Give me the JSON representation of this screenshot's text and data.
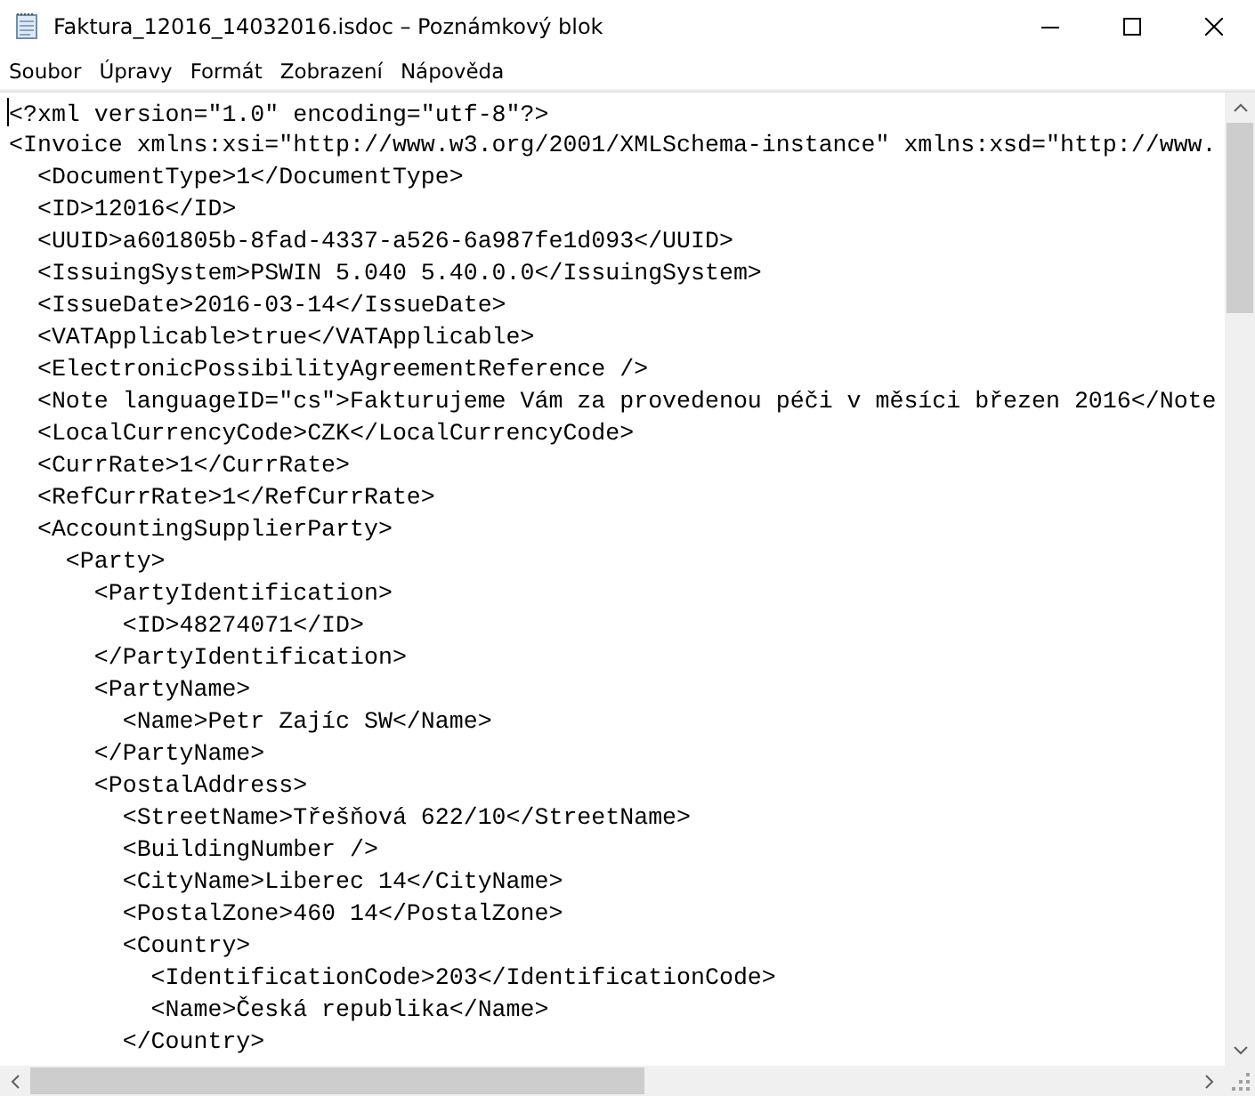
{
  "window": {
    "title": "Faktura_12016_14032016.isdoc – Poznámkový blok"
  },
  "menu": [
    "Soubor",
    "Úpravy",
    "Formát",
    "Zobrazení",
    "Nápověda"
  ],
  "editor": {
    "lines": [
      "<?xml version=\"1.0\" encoding=\"utf-8\"?>",
      "<Invoice xmlns:xsi=\"http://www.w3.org/2001/XMLSchema-instance\" xmlns:xsd=\"http://www.",
      "  <DocumentType>1</DocumentType>",
      "  <ID>12016</ID>",
      "  <UUID>a601805b-8fad-4337-a526-6a987fe1d093</UUID>",
      "  <IssuingSystem>PSWIN 5.040 5.40.0.0</IssuingSystem>",
      "  <IssueDate>2016-03-14</IssueDate>",
      "  <VATApplicable>true</VATApplicable>",
      "  <ElectronicPossibilityAgreementReference />",
      "  <Note languageID=\"cs\">Fakturujeme Vám za provedenou péči v měsíci březen 2016</Note",
      "  <LocalCurrencyCode>CZK</LocalCurrencyCode>",
      "  <CurrRate>1</CurrRate>",
      "  <RefCurrRate>1</RefCurrRate>",
      "  <AccountingSupplierParty>",
      "    <Party>",
      "      <PartyIdentification>",
      "        <ID>48274071</ID>",
      "      </PartyIdentification>",
      "      <PartyName>",
      "        <Name>Petr Zajíc SW</Name>",
      "      </PartyName>",
      "      <PostalAddress>",
      "        <StreetName>Třešňová 622/10</StreetName>",
      "        <BuildingNumber />",
      "        <CityName>Liberec 14</CityName>",
      "        <PostalZone>460 14</PostalZone>",
      "        <Country>",
      "          <IdentificationCode>203</IdentificationCode>",
      "          <Name>Česká republika</Name>",
      "        </Country>"
    ]
  }
}
